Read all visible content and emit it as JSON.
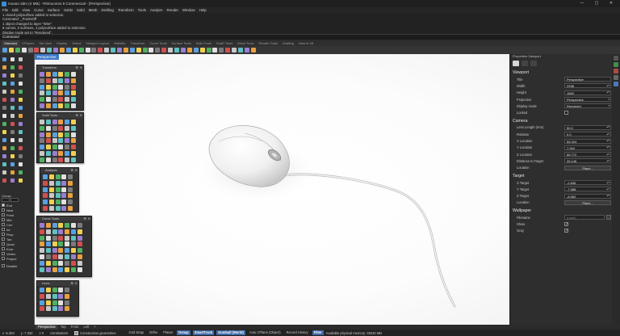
{
  "window": {
    "title": "mouse.3dm (4 MB) - Rhinoceros 8 Commercial - [Perspective]",
    "controls": [
      "—",
      "▢",
      "✕"
    ]
  },
  "menu": [
    "File",
    "Edit",
    "View",
    "Curve",
    "Surface",
    "SubD",
    "Solid",
    "Mesh",
    "Drafting",
    "Transform",
    "Tools",
    "Analyze",
    "Render",
    "Window",
    "Help"
  ],
  "history": [
    "1 closed polysurface added to selection.",
    "Command: _PointsOff",
    "1 object changed to layer \"Wire\".",
    "6 curves, 2 surfaces, 1 polysurface added to selection.",
    "Display mode set to \"Rendered\"."
  ],
  "command": {
    "label": "Command"
  },
  "tabs": [
    "Standard",
    "CPlanes",
    "Set View",
    "Display",
    "Select",
    "Viewport Layout",
    "Visibility",
    "Transform",
    "Curve Tools",
    "Surface Tools",
    "Solid Tools",
    "SubD Tools",
    "Mesh Tools",
    "Render Tools",
    "Drafting",
    "New in V8"
  ],
  "floating_panels": {
    "transform": "Transform",
    "solid_tools": "Solid Tools",
    "analysis": "Analysis",
    "curve_tools": "Curve Tools",
    "lines": "Lines"
  },
  "osnap": {
    "header": "Osnap",
    "items": [
      {
        "label": "End",
        "checked": true
      },
      {
        "label": "Near",
        "checked": false
      },
      {
        "label": "Point",
        "checked": false
      },
      {
        "label": "Mid",
        "checked": false
      },
      {
        "label": "Cen",
        "checked": false
      },
      {
        "label": "Int",
        "checked": false
      },
      {
        "label": "Perp",
        "checked": false
      },
      {
        "label": "Tan",
        "checked": false
      },
      {
        "label": "Quad",
        "checked": false
      },
      {
        "label": "Knot",
        "checked": false
      },
      {
        "label": "Vertex",
        "checked": false
      },
      {
        "label": "Project",
        "checked": false
      }
    ],
    "disable": "Disable"
  },
  "viewport": {
    "tab": "Perspective"
  },
  "properties": {
    "tabs": "Properties  Viewport",
    "viewport_section": "Viewport",
    "title_label": "Title",
    "title_value": "Perspective",
    "width_label": "Width",
    "width_value": "2938",
    "height_label": "Height",
    "height_value": "1663",
    "projection_label": "Projection",
    "projection_value": "Perspective",
    "display_mode_label": "Display mode",
    "display_mode_value": "Rendered",
    "locked_label": "Locked",
    "camera_section": "Camera",
    "lens_label": "Lens Length (mm)",
    "lens_value": "50.0",
    "rotation_label": "Rotation",
    "rotation_value": "0.0",
    "xloc_label": "X Location",
    "xloc_value": "55.324",
    "yloc_label": "Y Location",
    "yloc_value": "7.344",
    "zloc_label": "Z Location",
    "zloc_value": "55.772",
    "dist_label": "Distance to Target",
    "dist_value": "26.146",
    "location_label": "Location",
    "place_button": "Place...",
    "target_section": "Target",
    "tx_label": "X Target",
    "tx_value": "-2.846",
    "ty_label": "Y Target",
    "ty_value": "-7.988",
    "tz_label": "Z Target",
    "tz_value": "-8.962",
    "tlocation_label": "Location",
    "tplace_button": "Place...",
    "wallpaper_section": "Wallpaper",
    "filename_label": "Filename",
    "filename_value": "(none)",
    "show_label": "Show",
    "gray_label": "Gray"
  },
  "bottom_tabs": [
    "Perspective",
    "Top",
    "Front",
    "Left",
    "+"
  ],
  "status": {
    "x": "x -5.353",
    "y": "y -7.332",
    "z": "z 0",
    "units": "Centimeters",
    "layer": "Construction geometries",
    "panes": [
      {
        "label": "Grid Snap",
        "on": false
      },
      {
        "label": "Ortho",
        "on": false
      },
      {
        "label": "Planar",
        "on": false
      },
      {
        "label": "Osnap",
        "on": true
      },
      {
        "label": "SmartTrack",
        "on": true
      },
      {
        "label": "Gumball (World)",
        "on": true
      },
      {
        "label": "Auto CPlane (Object)",
        "on": false
      },
      {
        "label": "Record History",
        "on": false
      },
      {
        "label": "Filter",
        "on": true
      }
    ],
    "memory": "Available physical memory: 49240 MB"
  }
}
